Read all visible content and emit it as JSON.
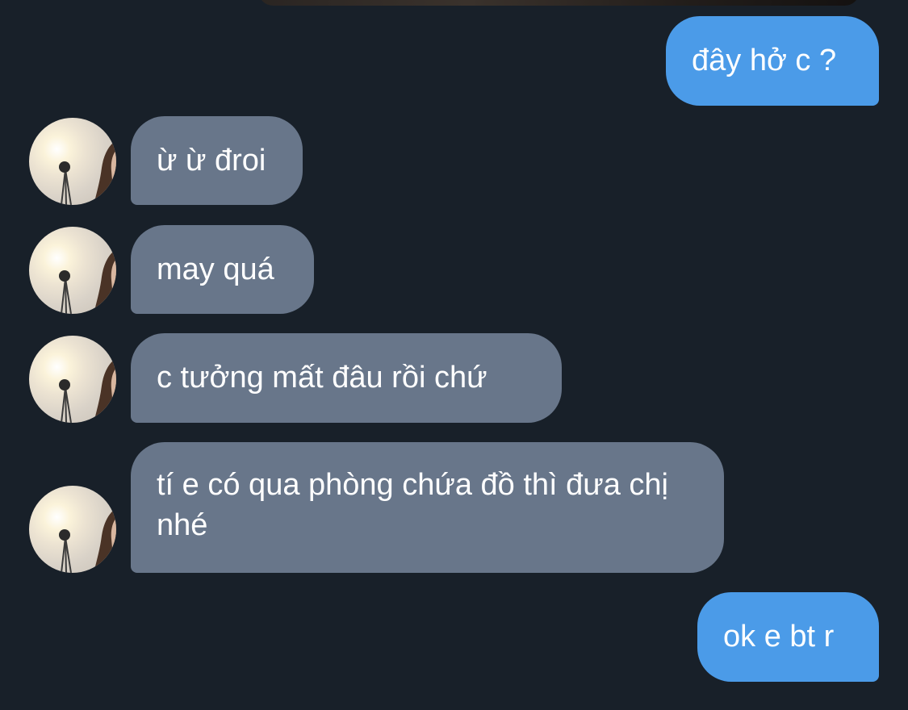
{
  "messages": [
    {
      "side": "out",
      "text": "đây hở c ?"
    },
    {
      "side": "in",
      "text": "ừ ừ đroi"
    },
    {
      "side": "in",
      "text": "may quá"
    },
    {
      "side": "in",
      "text": "c tưởng mất đâu rồi chứ"
    },
    {
      "side": "in",
      "text": "tí e có qua phòng chứa đồ thì đưa chị nhé"
    },
    {
      "side": "out",
      "text": "ok e bt r"
    }
  ],
  "colors": {
    "background": "#182029",
    "outgoing_bubble": "#4b9be8",
    "incoming_bubble": "#68768a",
    "text": "#ffffff"
  }
}
